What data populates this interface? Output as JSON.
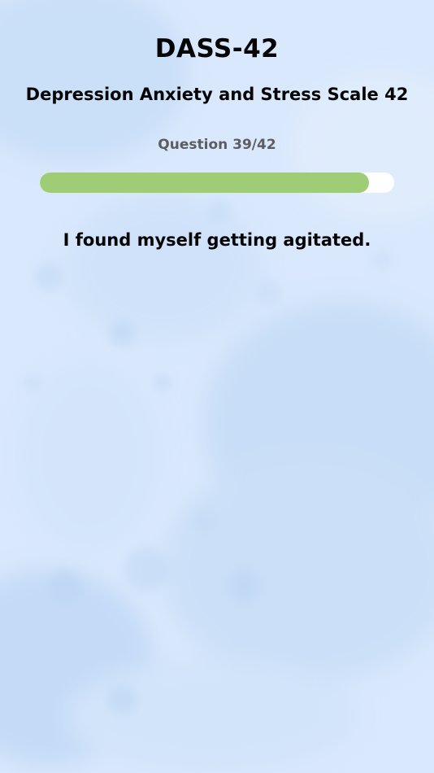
{
  "header": {
    "title": "DASS-42",
    "subtitle": "Depression Anxiety and Stress Scale 42"
  },
  "progress": {
    "label": "Question 39/42",
    "current": 39,
    "total": 42
  },
  "question": {
    "text": "I found myself getting agitated."
  },
  "colors": {
    "background": "#d6e6fb",
    "progress_fill": "#9fcd75",
    "progress_track": "#ffffff",
    "text_primary": "#050505",
    "text_secondary": "#5d5d5f"
  }
}
